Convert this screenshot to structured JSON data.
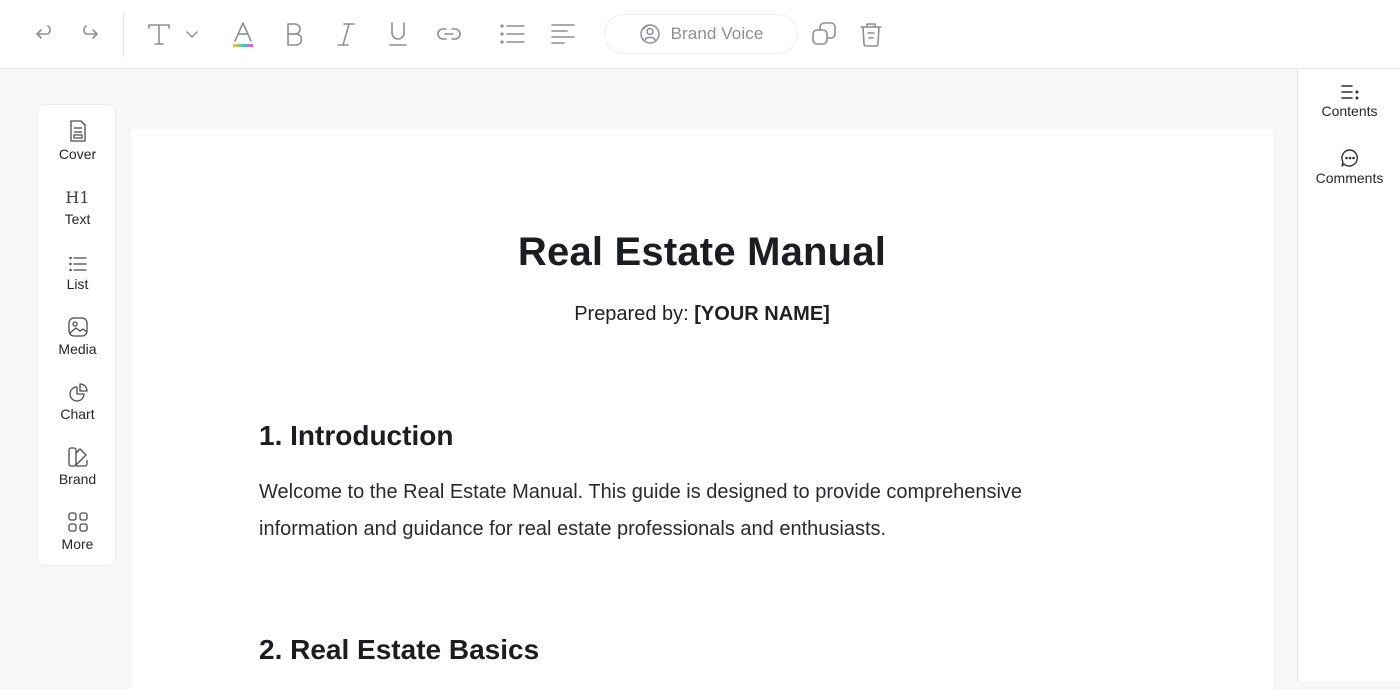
{
  "toolbar": {
    "brand_voice_label": "Brand Voice",
    "icons": [
      "undo-icon",
      "redo-icon",
      "text-style-icon",
      "chevron-down-icon",
      "text-color-icon",
      "bold-icon",
      "italic-icon",
      "underline-icon",
      "link-icon",
      "bullet-list-icon",
      "align-left-icon",
      "brand-voice-icon",
      "duplicate-icon",
      "delete-icon"
    ]
  },
  "leftbar": {
    "items": [
      {
        "label": "Cover",
        "icon": "cover-icon"
      },
      {
        "label": "Text",
        "icon": "heading-icon",
        "glyph": "H1"
      },
      {
        "label": "List",
        "icon": "list-icon"
      },
      {
        "label": "Media",
        "icon": "media-icon"
      },
      {
        "label": "Chart",
        "icon": "chart-icon"
      },
      {
        "label": "Brand",
        "icon": "brand-icon"
      },
      {
        "label": "More",
        "icon": "more-grid-icon"
      }
    ]
  },
  "rightbar": {
    "items": [
      {
        "label": "Contents",
        "icon": "contents-icon"
      },
      {
        "label": "Comments",
        "icon": "comments-icon"
      }
    ]
  },
  "document": {
    "title": "Real Estate Manual",
    "prepared_prefix": "Prepared by: ",
    "prepared_name": "[YOUR NAME]",
    "sections": [
      {
        "heading": "1. Introduction",
        "paragraph_line1": "Welcome to the Real Estate Manual. This guide is designed to provide comprehensive",
        "paragraph_line2": "information and guidance for real estate professionals and enthusiasts."
      },
      {
        "heading": "2. Real Estate Basics"
      }
    ]
  },
  "colors": {
    "toolbar_icon": "#8c8f96",
    "text": "#1f2023",
    "background": "#f7f7f8"
  }
}
